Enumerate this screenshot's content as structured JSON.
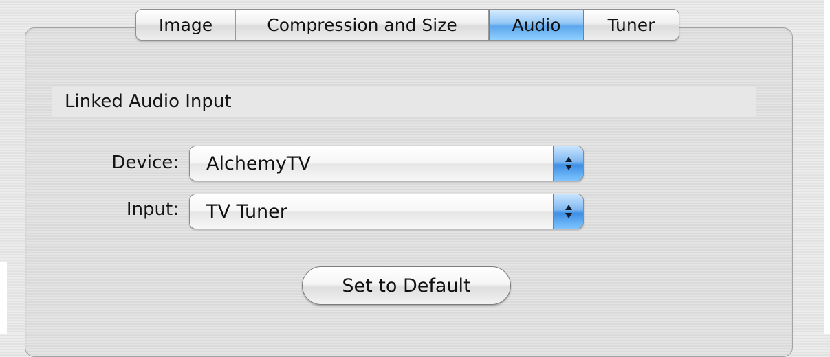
{
  "tabs": [
    {
      "label": "Image",
      "active": false
    },
    {
      "label": "Compression and Size",
      "active": false
    },
    {
      "label": "Audio",
      "active": true
    },
    {
      "label": "Tuner",
      "active": false
    }
  ],
  "section": {
    "title": "Linked Audio Input"
  },
  "device": {
    "label": "Device:",
    "value": "AlchemyTV"
  },
  "input": {
    "label": "Input:",
    "value": "TV Tuner"
  },
  "buttons": {
    "set_default": "Set to Default"
  },
  "colors": {
    "selection_accent": "#5ea6ec",
    "panel_background": "#e1e1e1"
  }
}
